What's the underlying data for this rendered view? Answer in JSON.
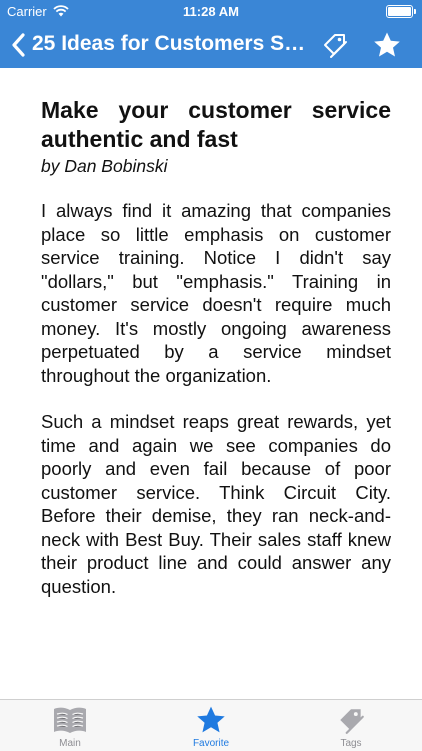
{
  "status_bar": {
    "carrier": "Carrier",
    "time": "11:28 AM"
  },
  "nav": {
    "title": "25 Ideas for Customers Ser...",
    "back_icon": "chevron-left-icon",
    "tag_icon": "tag-icon",
    "favorite_icon": "star-icon"
  },
  "article": {
    "title": "Make your customer service authentic and fast",
    "author": "by Dan Bobinski",
    "paragraphs": [
      "I always find it amazing that companies place so little emphasis on customer service training. Notice I didn't say \"dollars,\" but \"emphasis.\" Training in customer service doesn't require much money. It's mostly ongoing awareness perpetuated by a service mindset throughout the organization.",
      "Such a mindset reaps great rewards, yet time and again we see companies do poorly and even fail because of poor customer service. Think Circuit City. Before their demise, they ran neck-and-neck with Best Buy. Their sales staff knew their product line and could answer any question."
    ]
  },
  "tabs": [
    {
      "label": "Main",
      "icon": "book-icon",
      "selected": false
    },
    {
      "label": "Favorite",
      "icon": "star-icon",
      "selected": true
    },
    {
      "label": "Tags",
      "icon": "tag-icon",
      "selected": false
    }
  ],
  "colors": {
    "accent": "#3a86d6",
    "tab_selected": "#1f7ae0",
    "tab_unselected": "#8e8e93"
  }
}
